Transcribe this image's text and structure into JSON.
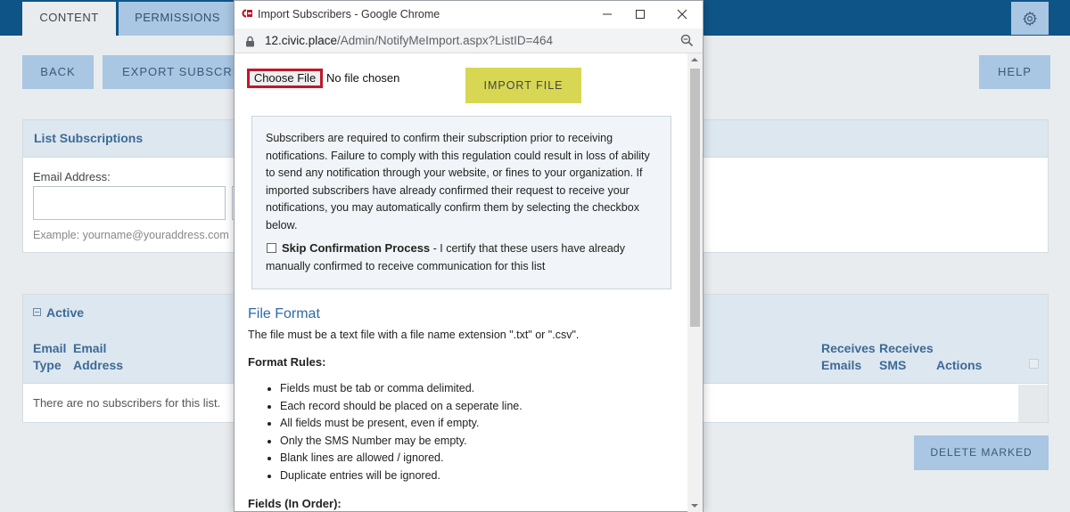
{
  "admin": {
    "tabs": [
      {
        "label": "CONTENT"
      },
      {
        "label": "PERMISSIONS"
      }
    ],
    "buttons": {
      "back": "BACK",
      "export": "EXPORT SUBSCRIPTIONS",
      "help": "HELP",
      "delete_marked": "DELETE MARKED"
    },
    "list_panel": {
      "title": "List Subscriptions",
      "email_label": "Email Address:",
      "email_value": "",
      "example": "Example: yourname@youraddress.com"
    },
    "active_panel": {
      "title": "Active",
      "columns": [
        {
          "label": "Email\nType"
        },
        {
          "label": "Email\nAddress"
        },
        {
          "label": "Receives\nEmails"
        },
        {
          "label": "Receives\nSMS"
        },
        {
          "label": "Actions"
        }
      ],
      "empty_message": "There are no subscribers for this list."
    }
  },
  "popup": {
    "window_title": "Import Subscribers - Google Chrome",
    "url_domain": "12.civic.place",
    "url_path": "/Admin/NotifyMeImport.aspx?ListID=464",
    "choose_file_label": "Choose File",
    "no_file_text": "No file chosen",
    "import_button": "IMPORT FILE",
    "notice_text": "Subscribers are required to confirm their subscription prior to receiving notifications. Failure to comply with this regulation could result in loss of ability to send any notification through your website, or fines to your organization. If imported subscribers have already confirmed their request to receive your notifications, you may automatically confirm them by selecting the checkbox below.",
    "skip_label": "Skip Confirmation Process",
    "skip_text": " - I certify that these users have already manually confirmed to receive communication for this list",
    "file_format_title": "File Format",
    "file_format_desc": "The file must be a text file with a file name extension \".txt\" or \".csv\".",
    "rules_title": "Format Rules:",
    "rules": [
      "Fields must be tab or comma delimited.",
      "Each record should be placed on a seperate line.",
      "All fields must be present, even if empty.",
      "Only the SMS Number may be empty.",
      "Blank lines are allowed / ignored.",
      "Duplicate entries will be ignored."
    ],
    "fields_title": "Fields (In Order):"
  },
  "colors": {
    "topbar": "#0f5486",
    "button_bg": "#a9c6e3",
    "import_button": "#d7d753",
    "focus_outline": "#c0172b",
    "heading_blue": "#3d6a96"
  }
}
